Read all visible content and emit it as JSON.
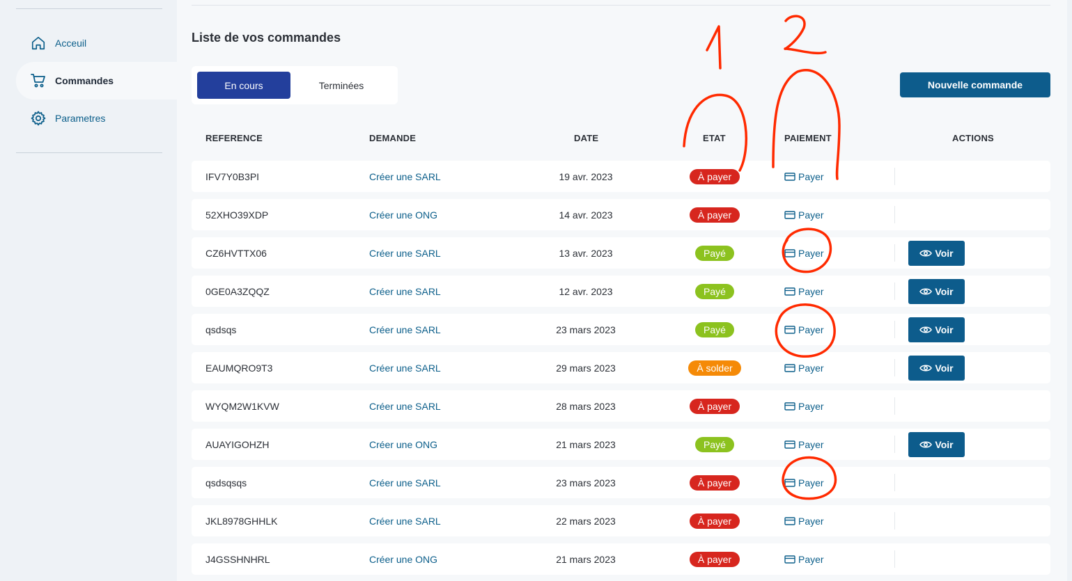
{
  "sidebar": {
    "items": [
      {
        "label": "Acceuil",
        "icon": "home-icon"
      },
      {
        "label": "Commandes",
        "icon": "cart-icon"
      },
      {
        "label": "Parametres",
        "icon": "gear-icon"
      }
    ]
  },
  "main": {
    "title": "Liste de vos commandes",
    "tabs": [
      {
        "label": "En cours"
      },
      {
        "label": "Terminées"
      }
    ],
    "new_order_label": "Nouvelle commande",
    "columns": [
      "REFERENCE",
      "DEMANDE",
      "DATE",
      "ETAT",
      "PAIEMENT",
      "ACTIONS"
    ],
    "pay_label": "Payer",
    "view_label": "Voir",
    "rows": [
      {
        "ref": "IFV7Y0B3PI",
        "demande": "Créer une SARL",
        "date": "19 avr. 2023",
        "etat": "À payer",
        "voir": false
      },
      {
        "ref": "52XHO39XDP",
        "demande": "Créer une ONG",
        "date": "14 avr. 2023",
        "etat": "À payer",
        "voir": false
      },
      {
        "ref": "CZ6HVTTX06",
        "demande": "Créer une SARL",
        "date": "13 avr. 2023",
        "etat": "Payé",
        "voir": true
      },
      {
        "ref": "0GE0A3ZQQZ",
        "demande": "Créer une SARL",
        "date": "12 avr. 2023",
        "etat": "Payé",
        "voir": true
      },
      {
        "ref": "qsdsqs",
        "demande": "Créer une SARL",
        "date": "23 mars 2023",
        "etat": "Payé",
        "voir": true
      },
      {
        "ref": "EAUMQRO9T3",
        "demande": "Créer une SARL",
        "date": "29 mars 2023",
        "etat": "À solder",
        "voir": true
      },
      {
        "ref": "WYQM2W1KVW",
        "demande": "Créer une SARL",
        "date": "28 mars 2023",
        "etat": "À payer",
        "voir": false
      },
      {
        "ref": "AUAYIGOHZH",
        "demande": "Créer une ONG",
        "date": "21 mars 2023",
        "etat": "Payé",
        "voir": true
      },
      {
        "ref": "qsdsqsqs",
        "demande": "Créer une SARL",
        "date": "23 mars 2023",
        "etat": "À payer",
        "voir": false
      },
      {
        "ref": "JKL8978GHHLK",
        "demande": "Créer une SARL",
        "date": "22 mars 2023",
        "etat": "À payer",
        "voir": false
      },
      {
        "ref": "J4GSSHNHRL",
        "demande": "Créer une ONG",
        "date": "21 mars 2023",
        "etat": "À payer",
        "voir": false
      }
    ]
  },
  "status_colors": {
    "À payer": "#d7261e",
    "Payé": "#8cc21f",
    "À solder": "#f58a07"
  },
  "annotations": {
    "labels": [
      "1",
      "2"
    ],
    "color": "#ff2a00"
  }
}
